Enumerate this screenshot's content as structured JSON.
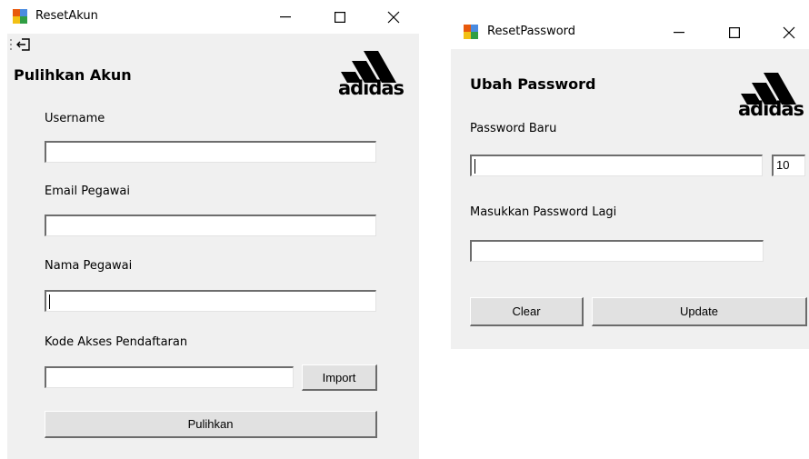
{
  "reset_akun": {
    "window_title": "ResetAkun",
    "heading": "Pulihkan Akun",
    "brand": "adidas",
    "username_label": "Username",
    "username_value": "",
    "email_label": "Email Pegawai",
    "email_value": "",
    "nama_label": "Nama Pegawai",
    "nama_value": "",
    "kode_label": "Kode Akses Pendaftaran",
    "kode_value": "",
    "import_label": "Import",
    "pulihkan_label": "Pulihkan"
  },
  "reset_password": {
    "window_title": "ResetPassword",
    "heading": "Ubah Password",
    "brand": "adidas",
    "password_baru_label": "Password Baru",
    "password_baru_value": "",
    "length_value": "10",
    "password_lagi_label": "Masukkan Password Lagi",
    "password_lagi_value": "",
    "clear_label": "Clear",
    "update_label": "Update"
  },
  "icons": {
    "app": "windows-form-icon",
    "minimize": "minimize-icon",
    "maximize": "maximize-icon",
    "close": "close-icon",
    "exit": "exit-icon",
    "logo": "adidas-logo"
  },
  "colors": {
    "form_background": "#f0f0f0",
    "titlebar_background": "#ffffff",
    "button_face": "#e1e1e1",
    "text": "#000000"
  }
}
